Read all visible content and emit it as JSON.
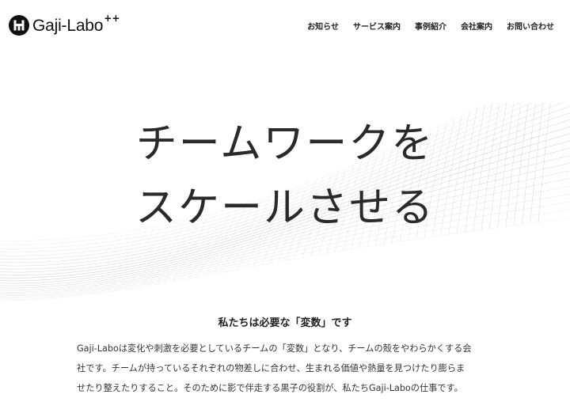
{
  "brand": {
    "name": "Gaji-Labo",
    "sup": "++"
  },
  "nav": [
    {
      "label": "お知らせ"
    },
    {
      "label": "サービス案内"
    },
    {
      "label": "事例紹介"
    },
    {
      "label": "会社案内"
    },
    {
      "label": "お問い合わせ"
    }
  ],
  "hero": {
    "line1": "チームワークを",
    "line2": "スケールさせる"
  },
  "intro": {
    "heading": "私たちは必要な「変数」です",
    "lines": [
      "Gaji-Laboは変化や刺激を必要としているチームの「変数」となり、チームの殻をやわらかくする会",
      "社です。チームが持っているそれぞれの物差しに合わせ、生まれる価値や熱量を見つけたり膨らま",
      "せたり整えたりすること。そのために影で伴走する黒子の役割が、私たちGaji-Laboの仕事です。"
    ]
  }
}
